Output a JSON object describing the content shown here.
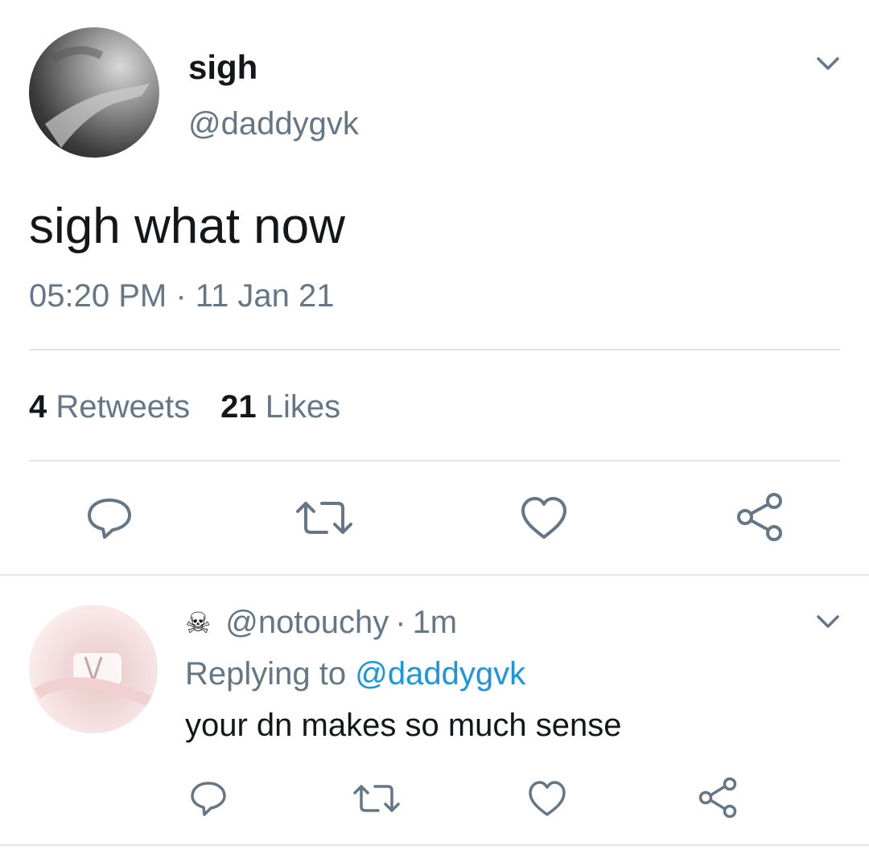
{
  "tweet": {
    "display_name": "sigh",
    "handle": "@daddygvk",
    "text": "sigh what now",
    "time": "05:20 PM",
    "separator": "·",
    "date": "11 Jan 21",
    "retweets_count": "4",
    "retweets_label": "Retweets",
    "likes_count": "21",
    "likes_label": "Likes"
  },
  "reply": {
    "emoji": "☠",
    "handle": "@notouchy",
    "separator": "·",
    "age": "1m",
    "replying_prefix": "Replying to",
    "replying_to": "@daddygvk",
    "text": "your dn makes so much sense"
  },
  "icons": {
    "reply": "reply-icon",
    "retweet": "retweet-icon",
    "like": "heart-icon",
    "share": "share-icon",
    "menu": "chevron-down-icon"
  },
  "colors": {
    "secondary_text": "#657786",
    "link": "#1b95e0",
    "divider": "#e1e8ed"
  }
}
